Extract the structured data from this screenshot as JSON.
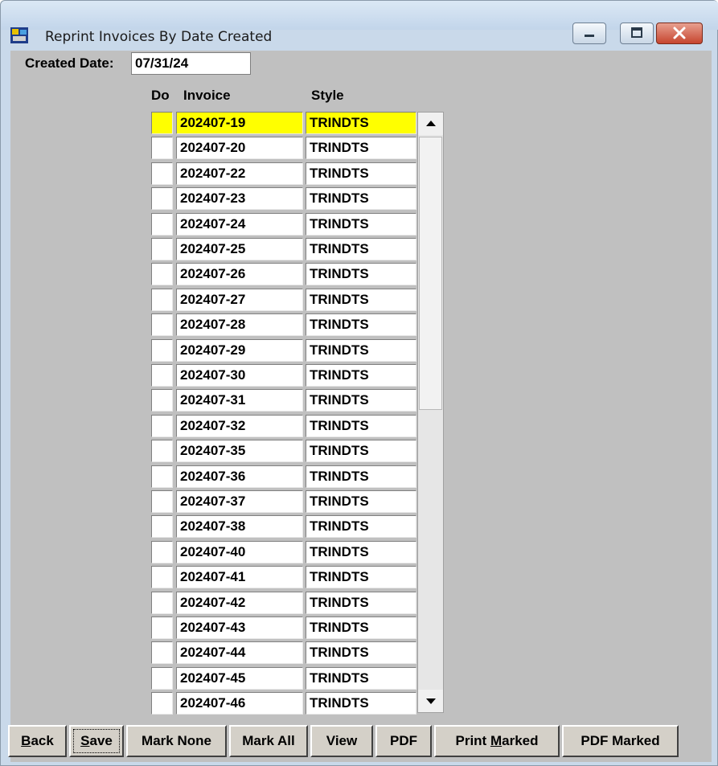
{
  "window": {
    "title": "Reprint Invoices By Date Created"
  },
  "form": {
    "created_date_label": "Created Date:",
    "created_date_value": "07/31/24"
  },
  "grid": {
    "headers": {
      "do": "Do",
      "invoice": "Invoice",
      "style": "Style"
    },
    "rows": [
      {
        "invoice": "202407-19",
        "style": "TRINDTS"
      },
      {
        "invoice": "202407-20",
        "style": "TRINDTS"
      },
      {
        "invoice": "202407-22",
        "style": "TRINDTS"
      },
      {
        "invoice": "202407-23",
        "style": "TRINDTS"
      },
      {
        "invoice": "202407-24",
        "style": "TRINDTS"
      },
      {
        "invoice": "202407-25",
        "style": "TRINDTS"
      },
      {
        "invoice": "202407-26",
        "style": "TRINDTS"
      },
      {
        "invoice": "202407-27",
        "style": "TRINDTS"
      },
      {
        "invoice": "202407-28",
        "style": "TRINDTS"
      },
      {
        "invoice": "202407-29",
        "style": "TRINDTS"
      },
      {
        "invoice": "202407-30",
        "style": "TRINDTS"
      },
      {
        "invoice": "202407-31",
        "style": "TRINDTS"
      },
      {
        "invoice": "202407-32",
        "style": "TRINDTS"
      },
      {
        "invoice": "202407-35",
        "style": "TRINDTS"
      },
      {
        "invoice": "202407-36",
        "style": "TRINDTS"
      },
      {
        "invoice": "202407-37",
        "style": "TRINDTS"
      },
      {
        "invoice": "202407-38",
        "style": "TRINDTS"
      },
      {
        "invoice": "202407-40",
        "style": "TRINDTS"
      },
      {
        "invoice": "202407-41",
        "style": "TRINDTS"
      },
      {
        "invoice": "202407-42",
        "style": "TRINDTS"
      },
      {
        "invoice": "202407-43",
        "style": "TRINDTS"
      },
      {
        "invoice": "202407-44",
        "style": "TRINDTS"
      },
      {
        "invoice": "202407-45",
        "style": "TRINDTS"
      },
      {
        "invoice": "202407-46",
        "style": "TRINDTS"
      }
    ],
    "highlight_color": "#ffff00"
  },
  "buttons": {
    "back": {
      "mn": "B",
      "rest": "ack"
    },
    "save": {
      "mn": "S",
      "rest": "ave"
    },
    "mark_none": "Mark None",
    "mark_all": "Mark All",
    "view": "View",
    "pdf": "PDF",
    "print_marked": {
      "pre": "Print ",
      "mn": "M",
      "rest": "arked"
    },
    "pdf_marked": "PDF Marked"
  },
  "icons": {
    "app": "app-icon",
    "minimize": "minimize-icon",
    "maximize": "maximize-icon",
    "close": "close-icon",
    "scroll_up": "scroll-up-arrow-icon",
    "scroll_down": "scroll-down-arrow-icon"
  }
}
